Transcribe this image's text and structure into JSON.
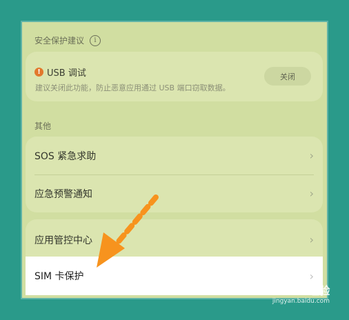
{
  "security": {
    "title": "安全保护建议",
    "info_icon": "i",
    "usb_warning_icon": "!",
    "usb_title": "USB 调试",
    "usb_description": "建议关闭此功能，防止恶意应用通过 USB 端口窃取数据。",
    "usb_button": "关闭"
  },
  "other": {
    "title": "其他",
    "items": [
      {
        "label": "SOS 紧急求助"
      },
      {
        "label": "应急预警通知"
      }
    ]
  },
  "app_control": {
    "label": "应用管控中心"
  },
  "sim_protection": {
    "label": "SIM 卡保护"
  },
  "chevron": "›",
  "watermark": {
    "brand": "Bai du 经验",
    "url": "jingyan.baidu.com"
  },
  "colors": {
    "background": "#2a9a8a",
    "screen": "#d1dea1",
    "card": "#dbe5b0",
    "highlight_row": "#ffffff",
    "arrow": "#f7931e",
    "warning": "#e2782c"
  }
}
